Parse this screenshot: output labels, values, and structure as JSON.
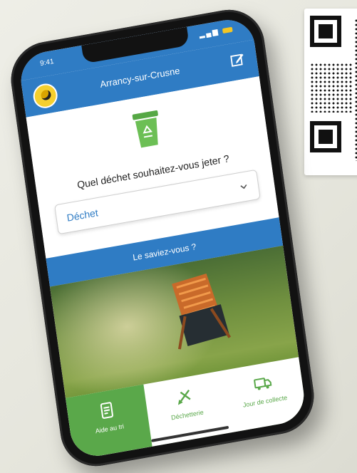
{
  "status_bar": {
    "time": "9:41"
  },
  "header": {
    "title": "Arrancy-sur-Crusne"
  },
  "main": {
    "question": "Quel déchet souhaitez-vous jeter ?",
    "waste_select": {
      "value": "Déchet"
    }
  },
  "banner": {
    "text": "Le saviez-vous ?"
  },
  "tabbar": {
    "items": [
      {
        "label": "Aide au tri",
        "icon": "sorting-guide-icon",
        "active": true
      },
      {
        "label": "Déchetterie",
        "icon": "recycling-center-icon",
        "active": false
      },
      {
        "label": "Jour de collecte",
        "icon": "collection-truck-icon",
        "active": false
      }
    ]
  },
  "colors": {
    "primary_blue": "#2f7cc4",
    "accent_green": "#5aa84a",
    "status_battery": "#f3c623"
  }
}
